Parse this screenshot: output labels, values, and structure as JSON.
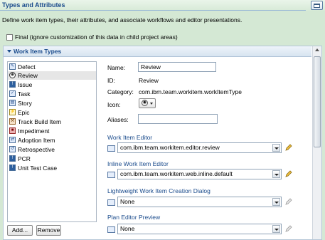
{
  "page": {
    "title": "Types and Attributes",
    "description": "Define work item types, their attributes, and associate workflows and editor presentations.",
    "final_checkbox_label": "Final (ignore customization of this data in child project areas)",
    "final_checked": false
  },
  "section": {
    "title": "Work Item Types"
  },
  "types": {
    "items": [
      {
        "label": "Defect",
        "icon": "defect-icon"
      },
      {
        "label": "Review",
        "icon": "review-icon"
      },
      {
        "label": "Issue",
        "icon": "issue-icon"
      },
      {
        "label": "Task",
        "icon": "task-icon"
      },
      {
        "label": "Story",
        "icon": "story-icon"
      },
      {
        "label": "Epic",
        "icon": "epic-icon"
      },
      {
        "label": "Track Build Item",
        "icon": "track-build-icon"
      },
      {
        "label": "Impediment",
        "icon": "impediment-icon"
      },
      {
        "label": "Adoption Item",
        "icon": "adoption-icon"
      },
      {
        "label": "Retrospective",
        "icon": "retrospective-icon"
      },
      {
        "label": "PCR",
        "icon": "pcr-icon"
      },
      {
        "label": "Unit Test Case",
        "icon": "unit-test-icon"
      }
    ],
    "selected": "Review"
  },
  "buttons": {
    "add": "Add...",
    "remove": "Remove"
  },
  "details": {
    "name_label": "Name:",
    "name_value": "Review",
    "id_label": "ID:",
    "id_value": "Review",
    "category_label": "Category:",
    "category_value": "com.ibm.team.workitem.workItemType",
    "icon_label": "Icon:",
    "aliases_label": "Aliases:",
    "aliases_value": ""
  },
  "editors": {
    "work_item_editor_label": "Work Item Editor",
    "work_item_editor_value": "com.ibm.team.workitem.editor.review",
    "inline_editor_label": "Inline Work Item Editor",
    "inline_editor_value": "com.ibm.team.workitem.web.inline.default",
    "lightweight_label": "Lightweight Work Item Creation Dialog",
    "lightweight_value": "None",
    "plan_preview_label": "Plan Editor Preview",
    "plan_preview_value": "None"
  },
  "colors": {
    "background": "#d4e8d4",
    "heading": "#1a4b8c",
    "panel": "#ffffff",
    "selection": "#e6e6e6"
  }
}
